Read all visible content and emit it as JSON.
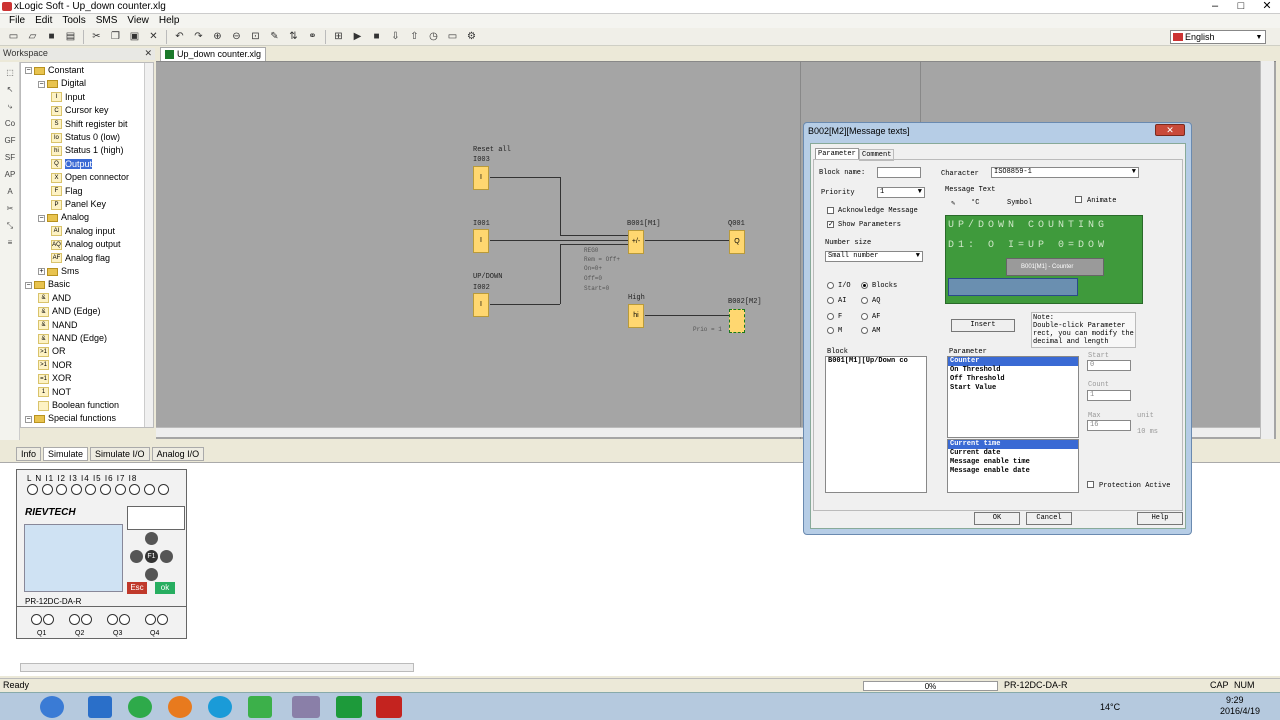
{
  "window": {
    "title": "xLogic Soft - Up_down counter.xlg"
  },
  "menu": [
    "File",
    "Edit",
    "Tools",
    "SMS",
    "View",
    "Help"
  ],
  "language": "English",
  "workspace": {
    "title": "Workspace"
  },
  "tree": [
    {
      "label": "Constant",
      "type": "folder",
      "level": 0
    },
    {
      "label": "Digital",
      "type": "folder",
      "level": 1
    },
    {
      "label": "Input",
      "icon": "I",
      "level": 2
    },
    {
      "label": "Cursor key",
      "icon": "C",
      "level": 2
    },
    {
      "label": "Shift register bit",
      "icon": "S",
      "level": 2
    },
    {
      "label": "Status 0 (low)",
      "icon": "lo",
      "level": 2
    },
    {
      "label": "Status 1 (high)",
      "icon": "hi",
      "level": 2
    },
    {
      "label": "Output",
      "icon": "Q",
      "level": 2,
      "selected": true
    },
    {
      "label": "Open connector",
      "icon": "X",
      "level": 2
    },
    {
      "label": "Flag",
      "icon": "F",
      "level": 2
    },
    {
      "label": "Panel Key",
      "icon": "P",
      "level": 2
    },
    {
      "label": "Analog",
      "type": "folder",
      "level": 1
    },
    {
      "label": "Analog input",
      "icon": "AI",
      "level": 2
    },
    {
      "label": "Analog output",
      "icon": "AQ",
      "level": 2
    },
    {
      "label": "Analog flag",
      "icon": "AF",
      "level": 2
    },
    {
      "label": "Sms",
      "type": "folder",
      "level": 1
    },
    {
      "label": "Basic",
      "type": "folder",
      "level": 0
    },
    {
      "label": "AND",
      "icon": "&",
      "level": 1
    },
    {
      "label": "AND (Edge)",
      "icon": "&",
      "level": 1
    },
    {
      "label": "NAND",
      "icon": "&",
      "level": 1
    },
    {
      "label": "NAND (Edge)",
      "icon": "&",
      "level": 1
    },
    {
      "label": "OR",
      "icon": ">1",
      "level": 1
    },
    {
      "label": "NOR",
      "icon": ">1",
      "level": 1
    },
    {
      "label": "XOR",
      "icon": "=1",
      "level": 1
    },
    {
      "label": "NOT",
      "icon": "1",
      "level": 1
    },
    {
      "label": "Boolean function",
      "icon": "",
      "level": 1
    },
    {
      "label": "Special functions",
      "type": "folder",
      "level": 0
    }
  ],
  "doc_tab": "Up_down counter.xlg",
  "diagram": {
    "reset_label": "Reset all",
    "i003": "I003",
    "i001": "I001",
    "updown_label": "UP/DOWN",
    "i002": "I002",
    "input_block": "I",
    "counter_name": "B001[M1]",
    "counter_symbol": "+/-",
    "q001": "Q001",
    "output_block": "Q",
    "params": [
      "REG0",
      "Rem = Off+",
      "On=0+",
      "Off=0",
      "Start=0"
    ],
    "high_label": "High",
    "hi_block": "hi",
    "msg_name": "B002[M2]",
    "prio": "Prio = 1"
  },
  "bottom_tabs": [
    "Info",
    "Simulate",
    "Simulate I/O",
    "Analog I/O"
  ],
  "plc": {
    "terminals": "L  N  I1 I2 I3 I4 I5 I6 I7 I8",
    "brand": "RIEVTECH",
    "model": "PR-12DC-DA-R",
    "esc": "Esc",
    "ok": "ok",
    "f1": "F1",
    "outputs": [
      "Q1",
      "Q2",
      "Q3",
      "Q4"
    ]
  },
  "status": {
    "left": "Ready",
    "progress": "0%",
    "model": "PR-12DC-DA-R",
    "cap": "CAP",
    "num": "NUM"
  },
  "taskbar": {
    "weather": "14°C",
    "time": "9:29",
    "date": "2016/4/19"
  },
  "dialog": {
    "title": "B002[M2][Message texts]",
    "tabs": [
      "Parameter",
      "Comment"
    ],
    "block_name_label": "Block name:",
    "block_name_value": "",
    "character_label": "Character",
    "character_value": "ISO8859-1",
    "priority_label": "Priority",
    "priority_value": "1",
    "ack_label": "Acknowledge Message",
    "show_params_label": "Show Parameters",
    "number_size_label": "Number size",
    "number_size_value": "Small number",
    "message_text_label": "Message Text",
    "degc": "°C",
    "symbol_label": "Symbol",
    "animate_label": "Animate",
    "lcd_row1": "UP/DOWN COUNTING",
    "lcd_row2": "D1: O I=UP 0=DOW",
    "lcd_popup": "B001[M1] - Counter",
    "radio_io": "I/O",
    "radio_blocks": "Blocks",
    "radio_ai": "AI",
    "radio_aq": "AQ",
    "radio_f": "F",
    "radio_af": "AF",
    "radio_m": "M",
    "radio_am": "AM",
    "insert_btn": "Insert",
    "note": "Note:\nDouble-click Parameter\nrect, you can modify the\ndecimal and length",
    "block_label": "Block",
    "block_item": "B001[M1][Up/Down co",
    "parameter_label": "Parameter",
    "params": [
      "Counter",
      "On Threshold",
      "Off Threshold",
      "Start Value"
    ],
    "times": [
      "Current time",
      "Current date",
      "Message enable time",
      "Message enable date"
    ],
    "start_label": "Start",
    "start_value": "0",
    "count_label": "Count",
    "count_value": "1",
    "max_label": "Max",
    "max_value": "16",
    "unit_label": "unit",
    "unit_value": "10 ms",
    "protection_label": "Protection Active",
    "ok_btn": "OK",
    "cancel_btn": "Cancel",
    "help_btn": "Help"
  }
}
